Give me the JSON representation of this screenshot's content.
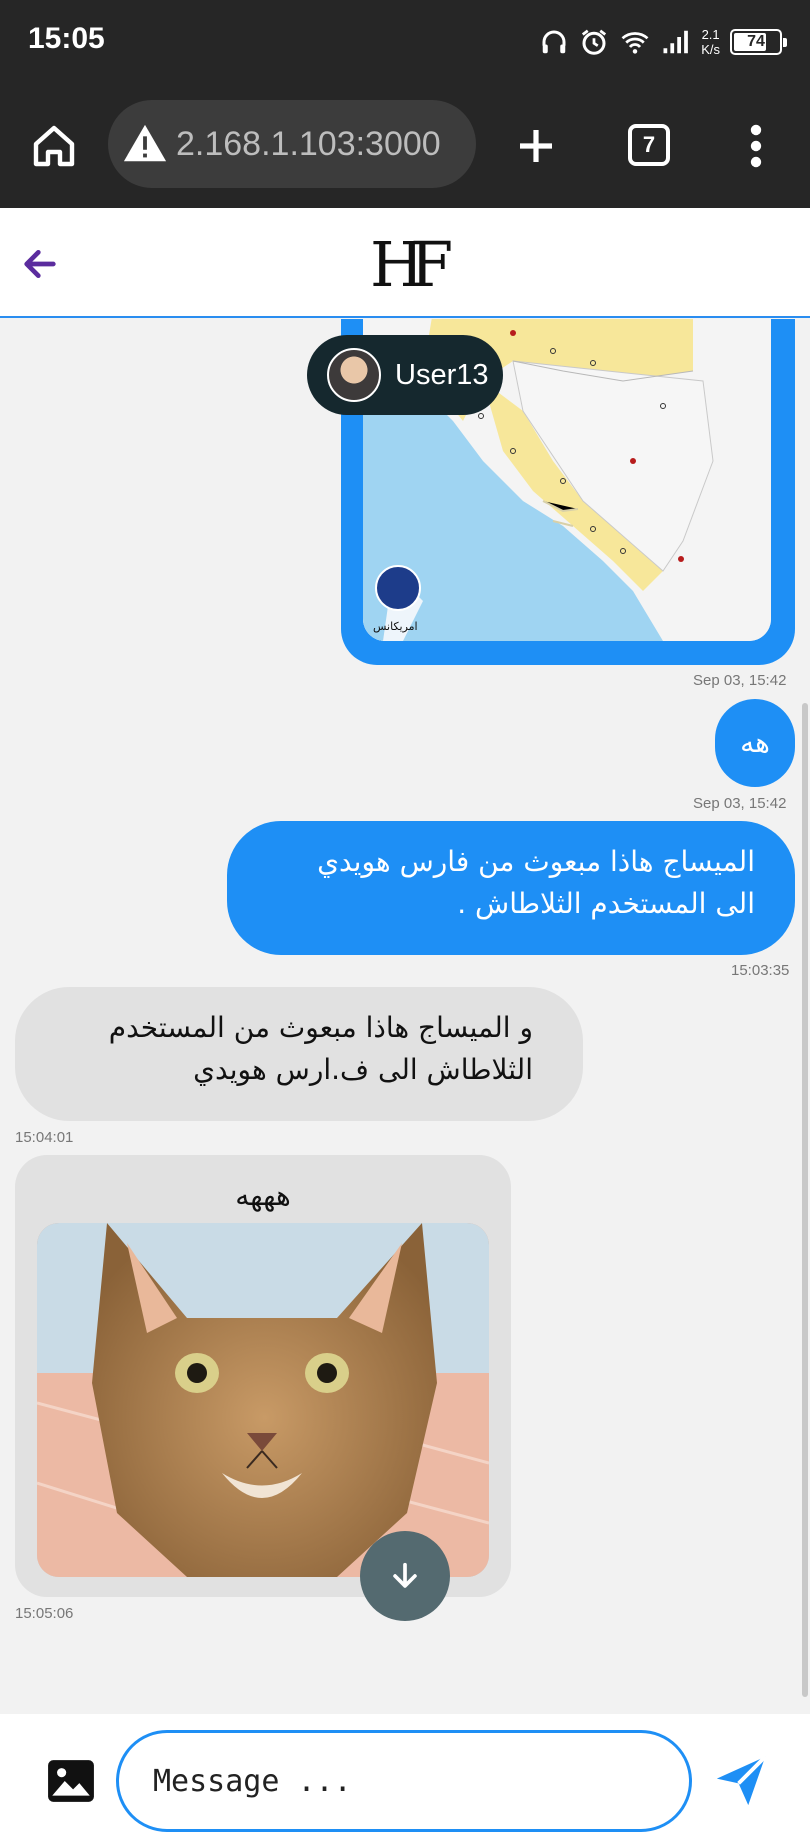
{
  "status_bar": {
    "time": "15:05",
    "net_speed_value": "2.1",
    "net_speed_unit": "K/s",
    "battery": "74",
    "battery_fraction": 0.74
  },
  "browser": {
    "url": "2.168.1.103:3000",
    "tab_count": "7"
  },
  "app": {
    "logo": "HF"
  },
  "chat": {
    "map_user_chip": "User13",
    "map_timestamp": "Sep 03, 15:42",
    "map_logo_text": "امريكانس",
    "messages": [
      {
        "side": "sent",
        "text": "هه",
        "timestamp": "Sep 03, 15:42"
      },
      {
        "side": "sent",
        "line1": "الميساج هاذا مبعوث من فارس هويدي",
        "line2": "الى المستخدم الثلاطاش .",
        "timestamp": "15:03:35"
      },
      {
        "side": "received",
        "line1": "و الميساج هاذا مبعوث من المستخدم",
        "line2": "الثلاطاش الى ف.ارس هويدي",
        "timestamp": "15:04:01"
      },
      {
        "side": "received",
        "caption": "هههه",
        "timestamp": "15:05:06"
      }
    ]
  },
  "composer": {
    "placeholder": "Message ..."
  },
  "colors": {
    "accent": "#1e8ff5",
    "received_bubble": "#e1e1e1",
    "chat_background": "#f2f2f2",
    "user_chip": "#15282e",
    "back_arrow": "#5b2c9e"
  }
}
